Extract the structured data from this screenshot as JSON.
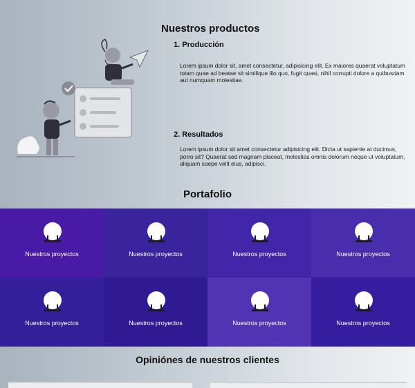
{
  "products": {
    "title": "Nuestros productos",
    "items": [
      {
        "title": "1. Producción",
        "text": "Lorem ipsum dolor sit, amet consectetur, adipisicing elit. Ex maiores quaerat voluptatum totam quae ad beatae sit similique illo quo, fugit quasi, nihil corrupti dolore a quibusdam aut numquam molestiae."
      },
      {
        "title": "2. Resultados",
        "text": "Lorem ipsum dolor sit amet consectetur adipisicing elit. Dicta ut sapiente at ducimus, porro sit? Quaerat sed magnam placeat, molestias omnis dolorum neque ut voluptatum, aliquam saepe velit eius, adipisci."
      }
    ]
  },
  "portfolio": {
    "title": "Portafolio",
    "tiles": [
      {
        "label": "Nuestros proyectos",
        "bg": "#5a1fa0"
      },
      {
        "label": "Nuestros proyectos",
        "bg": "#3b3590"
      },
      {
        "label": "Nuestros proyectos",
        "bg": "#4a3aa8"
      },
      {
        "label": "Nuestros proyectos",
        "bg": "#5a4ab0"
      },
      {
        "label": "Nuestros proyectos",
        "bg": "#2c2a88"
      },
      {
        "label": "Nuestros proyectos",
        "bg": "#22207a"
      },
      {
        "label": "Nuestros proyectos",
        "bg": "#6a5ac0"
      },
      {
        "label": "Nuestros proyectos",
        "bg": "#2d2790"
      }
    ]
  },
  "reviews": {
    "title": "Opiniónes de nuestros clientes"
  },
  "colors": {
    "accent": "#3a16aa",
    "illustration_gray": "#9a9aa2",
    "illustration_dark": "#2f2f3a"
  }
}
